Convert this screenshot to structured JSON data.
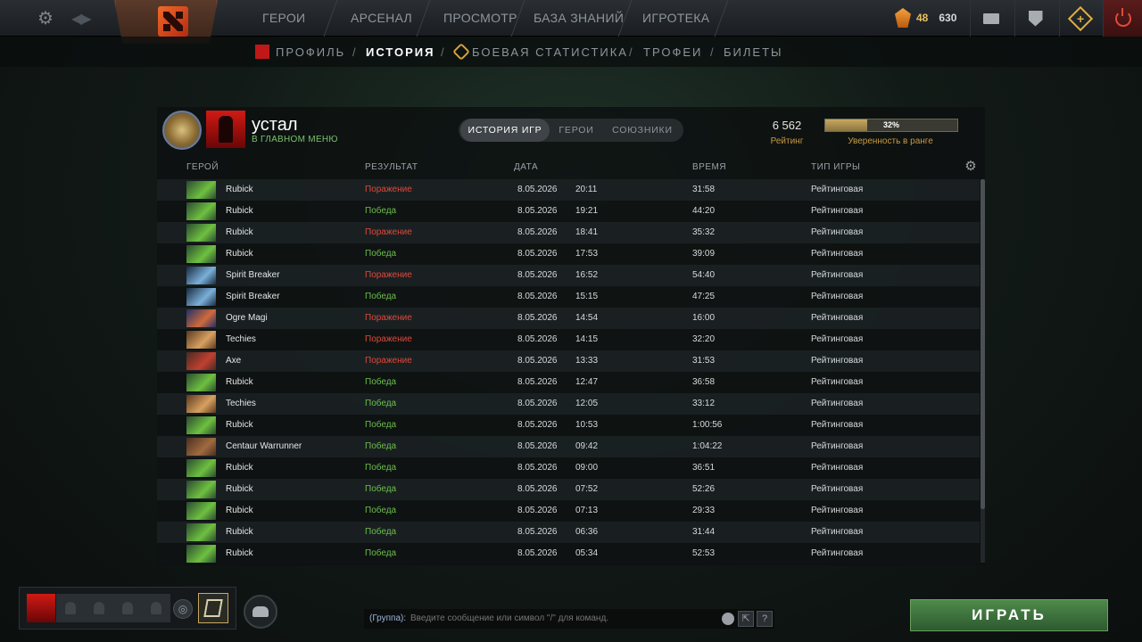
{
  "top_nav": {
    "items": [
      "ГЕРОИ",
      "АРСЕНАЛ",
      "ПРОСМОТР",
      "БАЗА ЗНАНИЙ",
      "ИГРОТЕКА"
    ],
    "currency_shards": "48",
    "currency_gold": "630"
  },
  "sub_nav": {
    "items": [
      "ПРОФИЛЬ",
      "ИСТОРИЯ",
      "БОЕВАЯ СТАТИСТИКА",
      "ТРОФЕИ",
      "БИЛЕТЫ"
    ],
    "active": "ИСТОРИЯ"
  },
  "player": {
    "name": "устал",
    "status": "В ГЛАВНОМ МЕНЮ"
  },
  "tabs": [
    "ИСТОРИЯ ИГР",
    "ГЕРОИ",
    "СОЮЗНИКИ"
  ],
  "rating": {
    "value": "6 562",
    "label": "Рейтинг",
    "confidence_text": "32%",
    "confidence_fraction": 0.32,
    "confidence_label": "Уверенность в ранге"
  },
  "columns": [
    "ГЕРОЙ",
    "РЕЗУЛЬТАТ",
    "ДАТА",
    "ВРЕМЯ",
    "ТИП ИГРЫ"
  ],
  "matches": [
    {
      "hero": "Rubick",
      "result": "Поражение",
      "outcome": "loss",
      "date": "8.05.2026",
      "time": "20:11",
      "duration": "31:58",
      "mode": "Рейтинговая"
    },
    {
      "hero": "Rubick",
      "result": "Победа",
      "outcome": "win",
      "date": "8.05.2026",
      "time": "19:21",
      "duration": "44:20",
      "mode": "Рейтинговая"
    },
    {
      "hero": "Rubick",
      "result": "Поражение",
      "outcome": "loss",
      "date": "8.05.2026",
      "time": "18:41",
      "duration": "35:32",
      "mode": "Рейтинговая"
    },
    {
      "hero": "Rubick",
      "result": "Победа",
      "outcome": "win",
      "date": "8.05.2026",
      "time": "17:53",
      "duration": "39:09",
      "mode": "Рейтинговая"
    },
    {
      "hero": "Spirit Breaker",
      "result": "Поражение",
      "outcome": "loss",
      "date": "8.05.2026",
      "time": "16:52",
      "duration": "54:40",
      "mode": "Рейтинговая"
    },
    {
      "hero": "Spirit Breaker",
      "result": "Победа",
      "outcome": "win",
      "date": "8.05.2026",
      "time": "15:15",
      "duration": "47:25",
      "mode": "Рейтинговая"
    },
    {
      "hero": "Ogre Magi",
      "result": "Поражение",
      "outcome": "loss",
      "date": "8.05.2026",
      "time": "14:54",
      "duration": "16:00",
      "mode": "Рейтинговая"
    },
    {
      "hero": "Techies",
      "result": "Поражение",
      "outcome": "loss",
      "date": "8.05.2026",
      "time": "14:15",
      "duration": "32:20",
      "mode": "Рейтинговая"
    },
    {
      "hero": "Axe",
      "result": "Поражение",
      "outcome": "loss",
      "date": "8.05.2026",
      "time": "13:33",
      "duration": "31:53",
      "mode": "Рейтинговая"
    },
    {
      "hero": "Rubick",
      "result": "Победа",
      "outcome": "win",
      "date": "8.05.2026",
      "time": "12:47",
      "duration": "36:58",
      "mode": "Рейтинговая"
    },
    {
      "hero": "Techies",
      "result": "Победа",
      "outcome": "win",
      "date": "8.05.2026",
      "time": "12:05",
      "duration": "33:12",
      "mode": "Рейтинговая"
    },
    {
      "hero": "Rubick",
      "result": "Победа",
      "outcome": "win",
      "date": "8.05.2026",
      "time": "10:53",
      "duration": "1:00:56",
      "mode": "Рейтинговая"
    },
    {
      "hero": "Centaur Warrunner",
      "result": "Победа",
      "outcome": "win",
      "date": "8.05.2026",
      "time": "09:42",
      "duration": "1:04:22",
      "mode": "Рейтинговая"
    },
    {
      "hero": "Rubick",
      "result": "Победа",
      "outcome": "win",
      "date": "8.05.2026",
      "time": "09:00",
      "duration": "36:51",
      "mode": "Рейтинговая"
    },
    {
      "hero": "Rubick",
      "result": "Победа",
      "outcome": "win",
      "date": "8.05.2026",
      "time": "07:52",
      "duration": "52:26",
      "mode": "Рейтинговая"
    },
    {
      "hero": "Rubick",
      "result": "Победа",
      "outcome": "win",
      "date": "8.05.2026",
      "time": "07:13",
      "duration": "29:33",
      "mode": "Рейтинговая"
    },
    {
      "hero": "Rubick",
      "result": "Победа",
      "outcome": "win",
      "date": "8.05.2026",
      "time": "06:36",
      "duration": "31:44",
      "mode": "Рейтинговая"
    },
    {
      "hero": "Rubick",
      "result": "Победа",
      "outcome": "win",
      "date": "8.05.2026",
      "time": "05:34",
      "duration": "52:53",
      "mode": "Рейтинговая"
    }
  ],
  "hero_colors": {
    "Rubick": [
      "#2a4a30",
      "#6ec040"
    ],
    "Spirit Breaker": [
      "#1a2a40",
      "#7ab0d8"
    ],
    "Ogre Magi": [
      "#22306a",
      "#d06a3a"
    ],
    "Techies": [
      "#5a3a20",
      "#d8a060"
    ],
    "Axe": [
      "#4a2a20",
      "#c04030"
    ],
    "Centaur Warrunner": [
      "#4a3020",
      "#a06a40"
    ]
  },
  "chat": {
    "channel": "(Группа):",
    "placeholder": "Введите сообщение или символ \"/\" для команд.",
    "help": "?"
  },
  "play_button": "ИГРАТЬ",
  "colors": {
    "loss": "#e0483a",
    "win": "#6cbe4c",
    "accent_gold": "#c89a40"
  }
}
